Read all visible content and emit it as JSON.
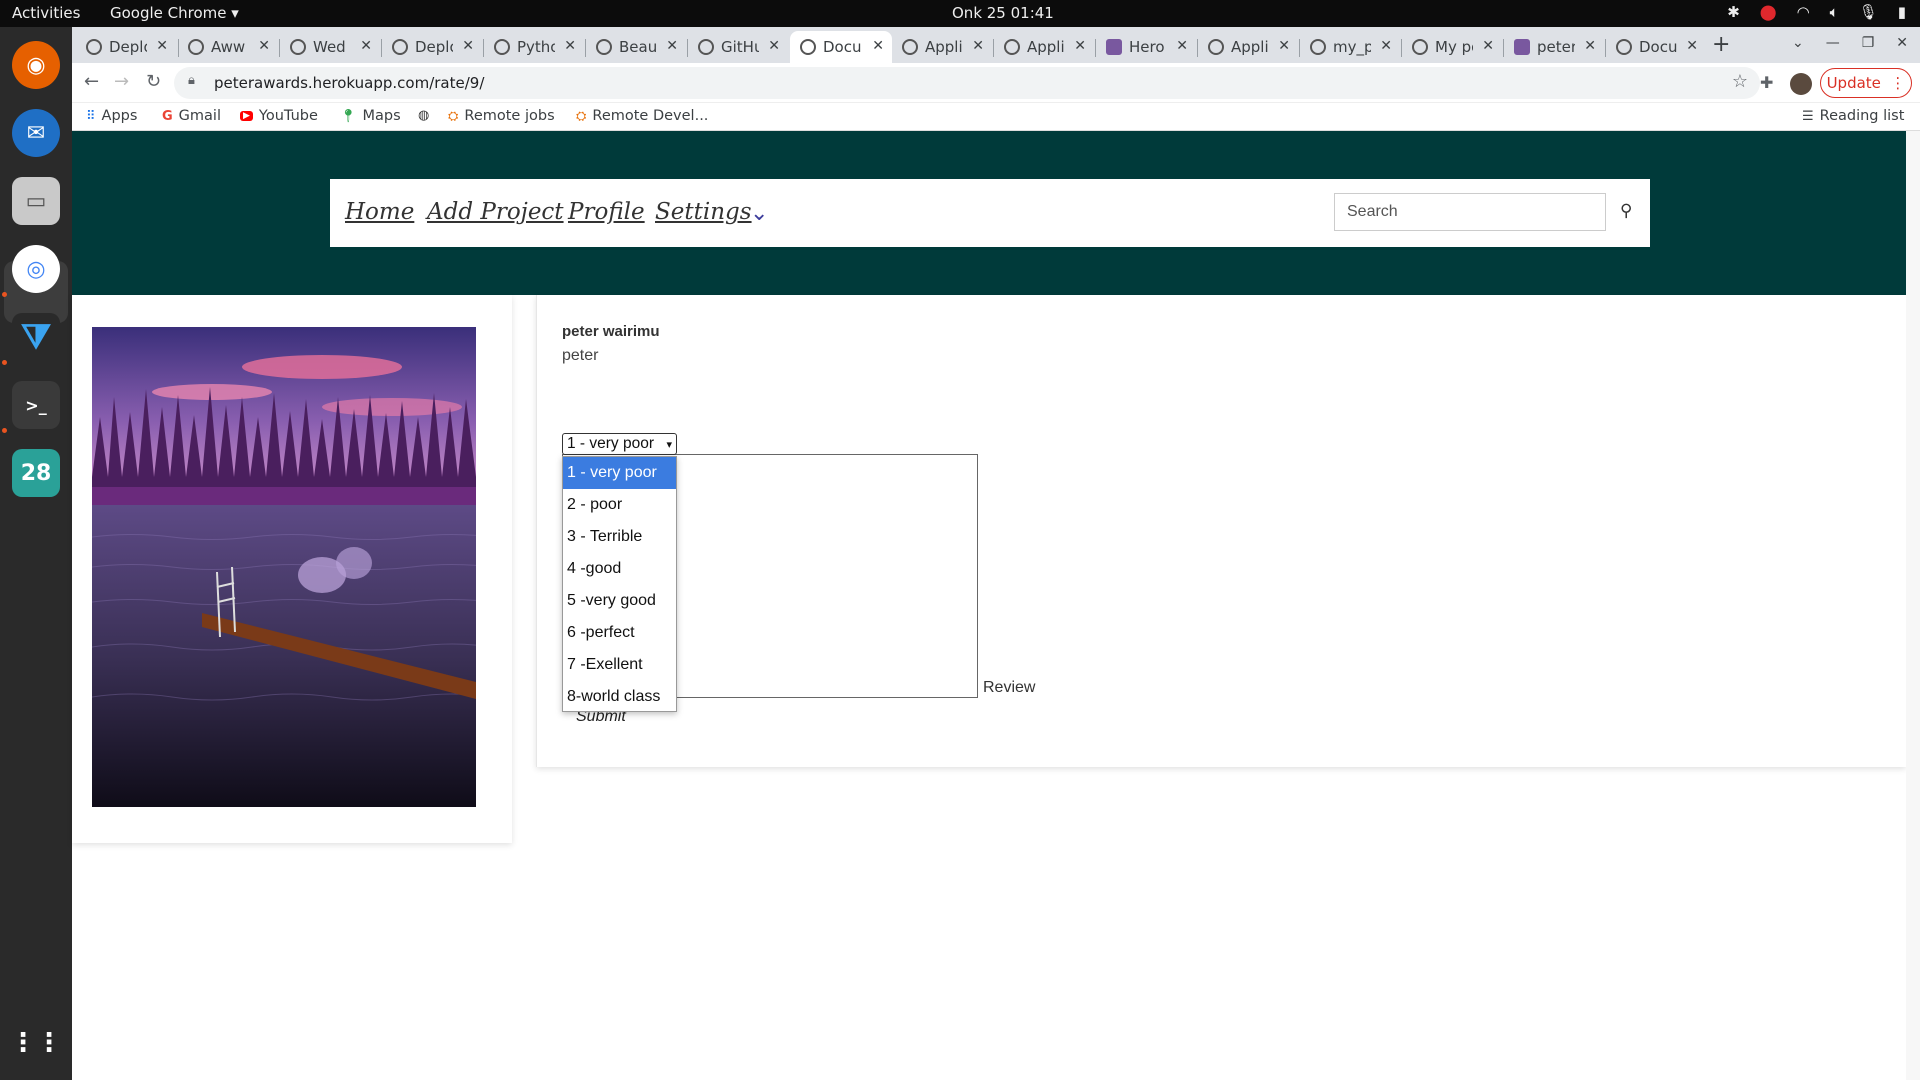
{
  "system": {
    "activities": "Activities",
    "app_menu": "Google Chrome ▾",
    "clock": "Onk 25  01:41",
    "dock_calendar_day": "28"
  },
  "tabs": [
    {
      "title": "Deplo"
    },
    {
      "title": "Aww"
    },
    {
      "title": "Wed"
    },
    {
      "title": "Deplo"
    },
    {
      "title": "Pytho"
    },
    {
      "title": "Beau"
    },
    {
      "title": "GitHu"
    },
    {
      "title": "Docu"
    },
    {
      "title": "Appli"
    },
    {
      "title": "Appli"
    },
    {
      "title": "Hero"
    },
    {
      "title": "Appli"
    },
    {
      "title": "my_p"
    },
    {
      "title": "My po"
    },
    {
      "title": "peter"
    },
    {
      "title": "Docu"
    }
  ],
  "browser": {
    "url": "peterawards.herokuapp.com/rate/9/",
    "update_label": "Update",
    "reading_list": "Reading list"
  },
  "bookmarks": [
    {
      "label": "Apps"
    },
    {
      "label": "Gmail"
    },
    {
      "label": "YouTube"
    },
    {
      "label": "Maps"
    },
    {
      "label": "Remote jobs"
    },
    {
      "label": "Remote Devel..."
    }
  ],
  "nav": {
    "home": "Home",
    "add_project": "Add Project",
    "profile": "Profile",
    "settings": "Settings",
    "search_placeholder": "Search"
  },
  "project": {
    "owner": "peter wairimu",
    "username": "peter"
  },
  "form": {
    "selected": "1 - very poor",
    "options": [
      "1 - very poor",
      "2 - poor",
      "3 - Terrible",
      "4 -good",
      "5 -very good",
      "6 -perfect",
      "7 -Exellent",
      "8-world class"
    ],
    "review_label": "Review",
    "submit_label": "Submit"
  },
  "colors": {
    "hero_bg": "#003a3a",
    "option_highlight": "#3b7ce0",
    "update_red": "#d93025"
  }
}
